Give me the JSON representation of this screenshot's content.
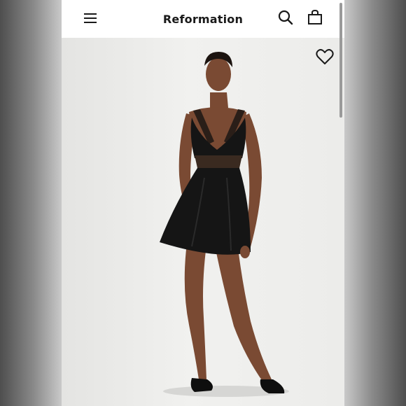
{
  "header": {
    "brand": "Reformation",
    "menu_icon": "hamburger-menu-icon",
    "search_icon": "search-icon",
    "bag_icon": "shopping-bag-icon"
  },
  "product": {
    "image_subject": "model-in-black-satin-mini-dress",
    "wishlist_icon": "heart-outline-icon"
  },
  "colors": {
    "header_bg": "#ffffff",
    "page_bg": "#eeeeec",
    "dress": "#151515",
    "skin": "#7a4a33"
  }
}
